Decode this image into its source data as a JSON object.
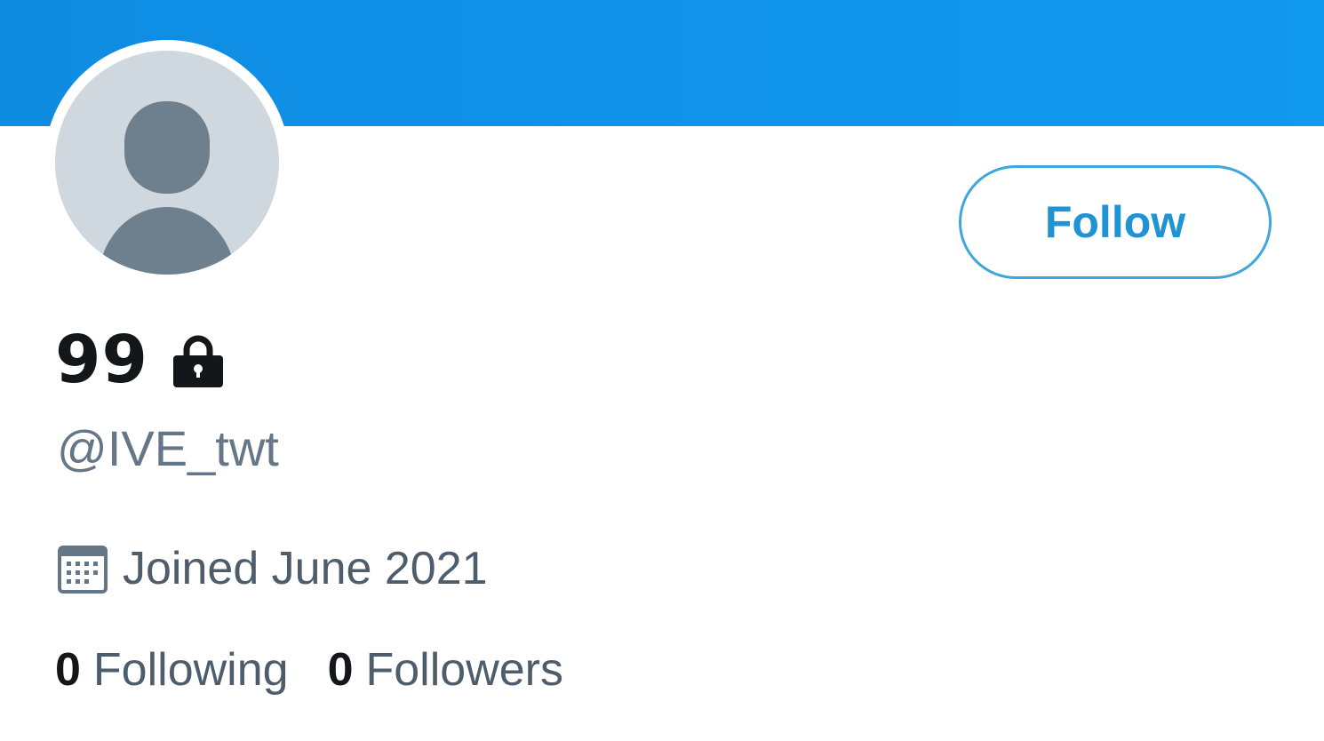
{
  "profile": {
    "display_name": "99",
    "handle": "@IVE_twt",
    "joined": "Joined June 2021",
    "protected_icon": "lock-icon",
    "avatar_icon": "default-avatar-silhouette"
  },
  "actions": {
    "follow_label": "Follow"
  },
  "stats": {
    "following_count": "0",
    "following_label": "Following",
    "followers_count": "0",
    "followers_label": "Followers"
  },
  "colors": {
    "banner": "#1199ef",
    "accent": "#1f93d4",
    "text_primary": "#14171a",
    "text_secondary": "#657786",
    "avatar_bg": "#cfd8de",
    "avatar_figure": "#6e7f8d"
  }
}
